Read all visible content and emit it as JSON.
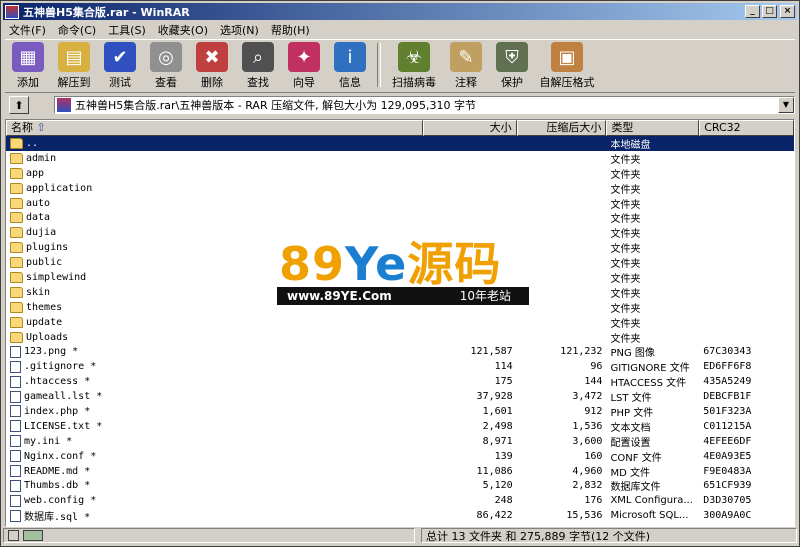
{
  "title": "五神兽H5集合版.rar - WinRAR",
  "window_buttons": {
    "min": "_",
    "max": "□",
    "close": "×"
  },
  "menu": [
    "文件(F)",
    "命令(C)",
    "工具(S)",
    "收藏夹(O)",
    "选项(N)",
    "帮助(H)"
  ],
  "toolbar": [
    {
      "label": "添加",
      "icon": "add-books-icon",
      "color": "#7a5cc0",
      "glyph": "▦"
    },
    {
      "label": "解压到",
      "icon": "extract-folder-icon",
      "color": "#d8b040",
      "glyph": "▤"
    },
    {
      "label": "测试",
      "icon": "test-check-icon",
      "color": "#3050c0",
      "glyph": "✔"
    },
    {
      "label": "查看",
      "icon": "view-glasses-icon",
      "color": "#909090",
      "glyph": "◎"
    },
    {
      "label": "删除",
      "icon": "delete-trash-icon",
      "color": "#c04040",
      "glyph": "✖"
    },
    {
      "label": "查找",
      "icon": "find-binoculars-icon",
      "color": "#505050",
      "glyph": "⌕"
    },
    {
      "label": "向导",
      "icon": "wizard-icon",
      "color": "#c03060",
      "glyph": "✦"
    },
    {
      "label": "信息",
      "icon": "info-icon",
      "color": "#3070c0",
      "glyph": "i"
    },
    {
      "label": "扫描病毒",
      "icon": "virus-scan-icon",
      "color": "#608030",
      "glyph": "☣"
    },
    {
      "label": "注释",
      "icon": "comment-icon",
      "color": "#c0a060",
      "glyph": "✎"
    },
    {
      "label": "保护",
      "icon": "protect-shield-icon",
      "color": "#607050",
      "glyph": "⛨"
    },
    {
      "label": "自解压格式",
      "icon": "sfx-icon",
      "color": "#c08040",
      "glyph": "▣"
    }
  ],
  "address": "五神兽H5集合版.rar\\五神兽版本 - RAR 压缩文件, 解包大小为 129,095,310 字节",
  "columns": {
    "name": "名称",
    "size": "大小",
    "packed": "压缩后大小",
    "type": "类型",
    "crc": "CRC32"
  },
  "rows": [
    {
      "name": "..",
      "size": "",
      "packed": "",
      "type": "本地磁盘",
      "crc": "",
      "kind": "folder",
      "selected": true
    },
    {
      "name": "admin",
      "size": "",
      "packed": "",
      "type": "文件夹",
      "crc": "",
      "kind": "folder"
    },
    {
      "name": "app",
      "size": "",
      "packed": "",
      "type": "文件夹",
      "crc": "",
      "kind": "folder"
    },
    {
      "name": "application",
      "size": "",
      "packed": "",
      "type": "文件夹",
      "crc": "",
      "kind": "folder"
    },
    {
      "name": "auto",
      "size": "",
      "packed": "",
      "type": "文件夹",
      "crc": "",
      "kind": "folder"
    },
    {
      "name": "data",
      "size": "",
      "packed": "",
      "type": "文件夹",
      "crc": "",
      "kind": "folder"
    },
    {
      "name": "dujia",
      "size": "",
      "packed": "",
      "type": "文件夹",
      "crc": "",
      "kind": "folder"
    },
    {
      "name": "plugins",
      "size": "",
      "packed": "",
      "type": "文件夹",
      "crc": "",
      "kind": "folder"
    },
    {
      "name": "public",
      "size": "",
      "packed": "",
      "type": "文件夹",
      "crc": "",
      "kind": "folder"
    },
    {
      "name": "simplewind",
      "size": "",
      "packed": "",
      "type": "文件夹",
      "crc": "",
      "kind": "folder"
    },
    {
      "name": "skin",
      "size": "",
      "packed": "",
      "type": "文件夹",
      "crc": "",
      "kind": "folder"
    },
    {
      "name": "themes",
      "size": "",
      "packed": "",
      "type": "文件夹",
      "crc": "",
      "kind": "folder"
    },
    {
      "name": "update",
      "size": "",
      "packed": "",
      "type": "文件夹",
      "crc": "",
      "kind": "folder"
    },
    {
      "name": "Uploads",
      "size": "",
      "packed": "",
      "type": "文件夹",
      "crc": "",
      "kind": "folder"
    },
    {
      "name": "123.png *",
      "size": "121,587",
      "packed": "121,232",
      "type": "PNG 图像",
      "crc": "67C30343",
      "kind": "file"
    },
    {
      "name": ".gitignore *",
      "size": "114",
      "packed": "96",
      "type": "GITIGNORE 文件",
      "crc": "ED6FF6F8",
      "kind": "file"
    },
    {
      "name": ".htaccess *",
      "size": "175",
      "packed": "144",
      "type": "HTACCESS 文件",
      "crc": "435A5249",
      "kind": "file"
    },
    {
      "name": "gameall.lst *",
      "size": "37,928",
      "packed": "3,472",
      "type": "LST 文件",
      "crc": "DEBCFB1F",
      "kind": "file"
    },
    {
      "name": "index.php *",
      "size": "1,601",
      "packed": "912",
      "type": "PHP 文件",
      "crc": "501F323A",
      "kind": "file"
    },
    {
      "name": "LICENSE.txt *",
      "size": "2,498",
      "packed": "1,536",
      "type": "文本文档",
      "crc": "C011215A",
      "kind": "file"
    },
    {
      "name": "my.ini *",
      "size": "8,971",
      "packed": "3,600",
      "type": "配置设置",
      "crc": "4EFEE6DF",
      "kind": "file"
    },
    {
      "name": "Nginx.conf *",
      "size": "139",
      "packed": "160",
      "type": "CONF 文件",
      "crc": "4E0A93E5",
      "kind": "file"
    },
    {
      "name": "README.md *",
      "size": "11,086",
      "packed": "4,960",
      "type": "MD 文件",
      "crc": "F9E0483A",
      "kind": "file"
    },
    {
      "name": "Thumbs.db *",
      "size": "5,120",
      "packed": "2,832",
      "type": "数据库文件",
      "crc": "651CF939",
      "kind": "file"
    },
    {
      "name": "web.config *",
      "size": "248",
      "packed": "176",
      "type": "XML Configura...",
      "crc": "D3D30705",
      "kind": "file"
    },
    {
      "name": "数据库.sql *",
      "size": "86,422",
      "packed": "15,536",
      "type": "Microsoft SQL...",
      "crc": "300A9A0C",
      "kind": "file"
    }
  ],
  "status": "总计 13 文件夹 和 275,889 字节(12 个文件)",
  "watermark": {
    "brand_a": "89",
    "brand_b": "Ye",
    "brand_c": "源码",
    "url": "www.89YE.Com",
    "slogan": "10年老站"
  }
}
